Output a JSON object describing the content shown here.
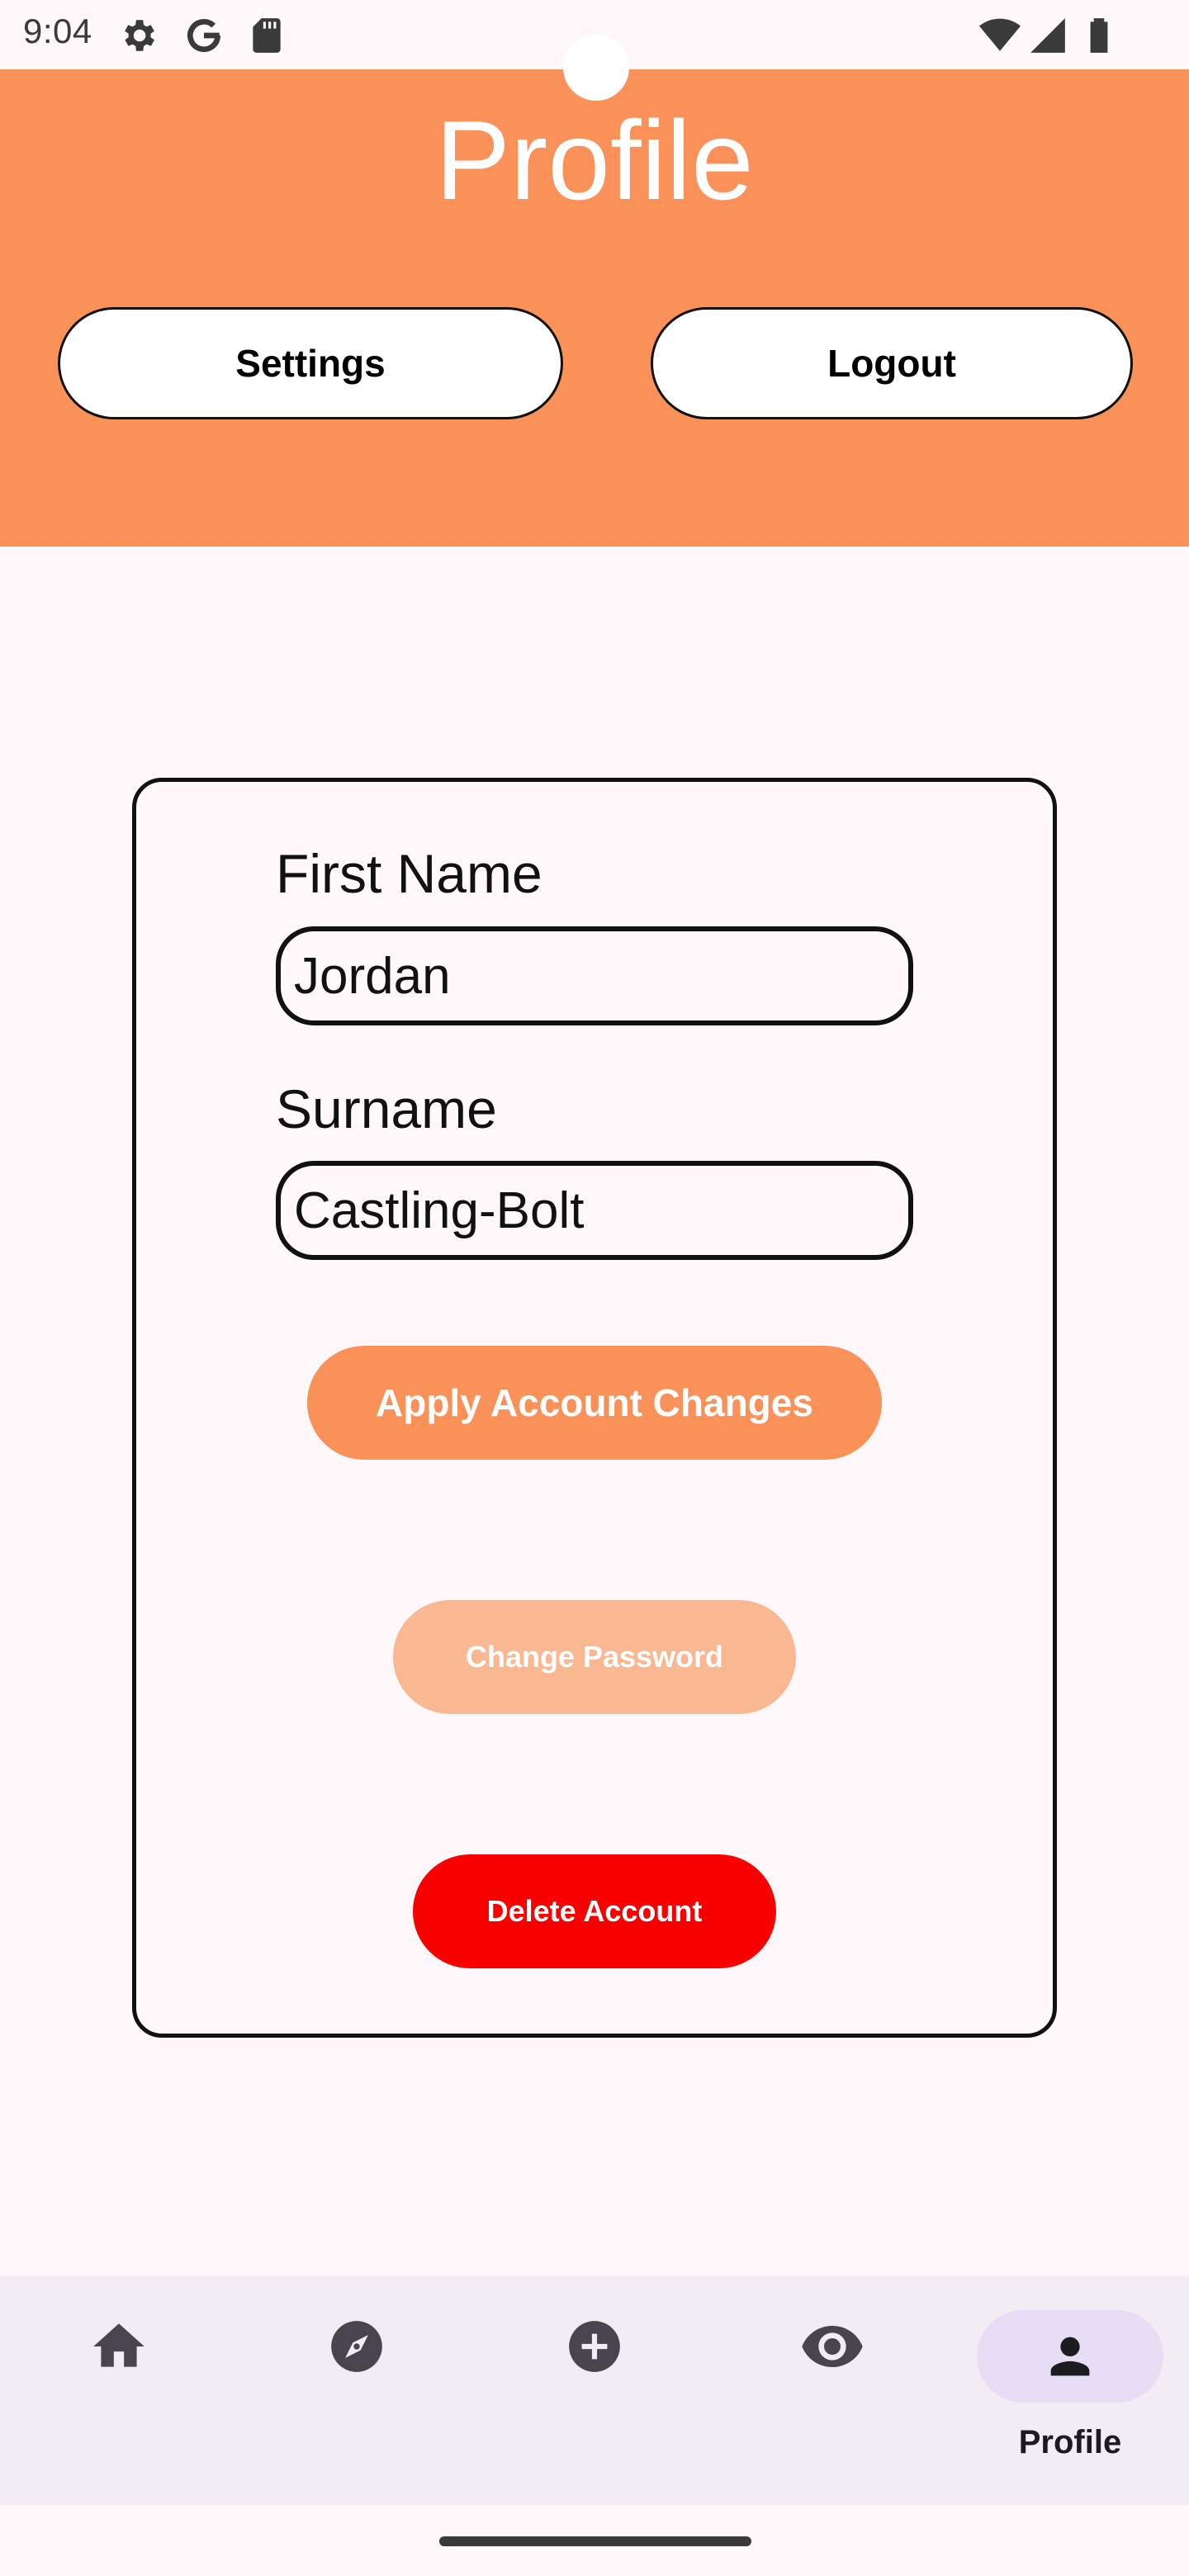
{
  "status_bar": {
    "time": "9:04",
    "left_icons": [
      "gear-icon",
      "google-g-icon",
      "sd-card-icon"
    ],
    "right_icons": [
      "wifi-icon",
      "signal-icon",
      "battery-icon"
    ]
  },
  "header": {
    "title": "Profile",
    "settings_label": "Settings",
    "logout_label": "Logout",
    "background_color": "#fa9159"
  },
  "form": {
    "first_name_label": "First Name",
    "first_name_value": "Jordan",
    "surname_label": "Surname",
    "surname_value": "Castling-Bolt",
    "apply_label": "Apply Account Changes",
    "change_password_label": "Change Password",
    "delete_label": "Delete Account"
  },
  "colors": {
    "accent": "#fa9159",
    "accent_disabled": "#f9b792",
    "danger": "#fb0000",
    "nav_background": "#f2ecf5",
    "nav_active_indicator": "#e7ddf5"
  },
  "bottom_nav": {
    "items": [
      {
        "icon": "home-icon",
        "label": ""
      },
      {
        "icon": "compass-icon",
        "label": ""
      },
      {
        "icon": "add-circle-icon",
        "label": ""
      },
      {
        "icon": "eye-icon",
        "label": ""
      },
      {
        "icon": "person-icon",
        "label": "Profile",
        "active": true
      }
    ]
  }
}
